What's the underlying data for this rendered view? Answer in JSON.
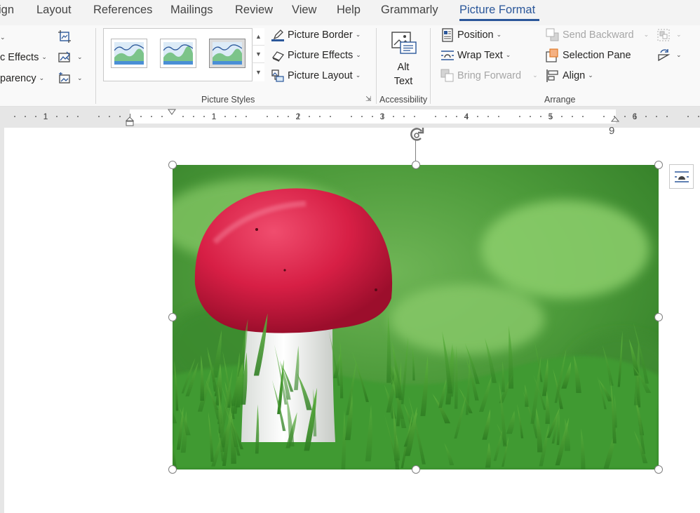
{
  "tabs": [
    {
      "label": "ign"
    },
    {
      "label": "Layout"
    },
    {
      "label": "References"
    },
    {
      "label": "Mailings"
    },
    {
      "label": "Review"
    },
    {
      "label": "View"
    },
    {
      "label": "Help"
    },
    {
      "label": "Grammarly"
    },
    {
      "label": "Picture Format"
    }
  ],
  "ribbon": {
    "left": {
      "effects_label": "c Effects",
      "transparency_label": "parency"
    },
    "picture_styles": {
      "group_label": "Picture Styles",
      "border_label": "Picture Border",
      "effects_label": "Picture Effects",
      "layout_label": "Picture Layout"
    },
    "accessibility": {
      "alt_line1": "Alt",
      "alt_line2": "Text",
      "group_label": "Accessibility"
    },
    "arrange": {
      "position_label": "Position",
      "wrap_label": "Wrap Text",
      "bring_forward_label": "Bring Forward",
      "send_backward_label": "Send Backward",
      "selection_pane_label": "Selection Pane",
      "align_label": "Align",
      "group_label": "Arrange"
    }
  },
  "ruler": {
    "numbers": [
      "1",
      "1",
      "2",
      "3",
      "4",
      "5",
      "6"
    ],
    "tail_marker": "9"
  },
  "colors": {
    "accent": "#2b579a",
    "ribbon_bg": "#f9f9f9",
    "ruler_bg": "#e6e6e6"
  }
}
